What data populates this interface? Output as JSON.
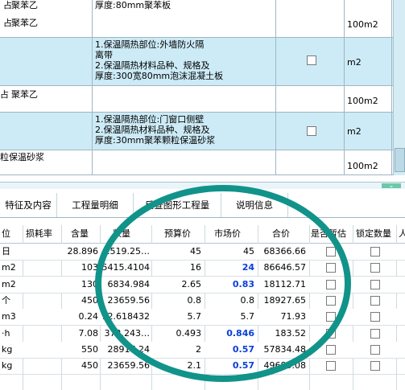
{
  "top_rows": [
    {
      "name": "聚苯乙",
      "prefix": "",
      "desc": "厚度:80mm聚苯板",
      "unit": "100m2",
      "checkbox": false
    },
    {
      "name": "",
      "prefix": "",
      "desc": "1.保温隔热部位:外墙防火隔\n离带\n2.保温隔热材料品种、规格及\n厚度:300宽80mm泡沫混凝土板",
      "unit": "m2",
      "checkbox": true
    },
    {
      "name": "聚苯乙",
      "prefix": "占",
      "desc": "",
      "unit": "100m2",
      "checkbox": false
    },
    {
      "name": "",
      "prefix": "",
      "desc": "1.保温隔热部位:门窗口侧壁\n2.保温隔热材料品种、规格及\n厚度:30mm聚苯颗粒保温砂浆",
      "unit": "m2",
      "checkbox": true
    },
    {
      "name": "粒保温砂浆",
      "prefix": "",
      "desc": "",
      "unit": "100m2",
      "checkbox": false
    }
  ],
  "first_row_prefix": "占",
  "tabs": [
    "特征及内容",
    "工程量明细",
    "反查图形工程量",
    "说明信息"
  ],
  "columns": [
    "位",
    "损耗率",
    "含量",
    "数量",
    "预算价",
    "市场价",
    "合价",
    "是否暂估",
    "锁定数量",
    "人"
  ],
  "rows": [
    {
      "unit": "日",
      "loss": "",
      "content": "28.896",
      "qty": "1519.25…",
      "budget": "45",
      "market": "45",
      "total": "68366.66",
      "market_bold": false
    },
    {
      "unit": "m2",
      "loss": "",
      "content": "103",
      "qty": "5415.4104",
      "budget": "16",
      "market": "24",
      "total": "86646.57",
      "market_bold": true
    },
    {
      "unit": "m2",
      "loss": "",
      "content": "130",
      "qty": "6834.984",
      "budget": "2.65",
      "market": "0.83",
      "total": "18112.71",
      "market_bold": true
    },
    {
      "unit": "个",
      "loss": "",
      "content": "450",
      "qty": "23659.56",
      "budget": "0.8",
      "market": "0.8",
      "total": "18927.65",
      "market_bold": false
    },
    {
      "unit": "m3",
      "loss": "",
      "content": "0.24",
      "qty": "12.618432",
      "budget": "5.7",
      "market": "5.7",
      "total": "71.93",
      "market_bold": false
    },
    {
      "unit": "·h",
      "loss": "",
      "content": "7.08",
      "qty": "372.243…",
      "budget": "0.493",
      "market": "0.846",
      "total": "183.52",
      "market_bold": true
    },
    {
      "unit": "kg",
      "loss": "",
      "content": "550",
      "qty": "28917.24",
      "budget": "2",
      "market": "0.57",
      "total": "57834.48",
      "market_bold": true
    },
    {
      "unit": "kg",
      "loss": "",
      "content": "450",
      "qty": "23659.56",
      "budget": "2.1",
      "market": "0.57",
      "total": "49685.08",
      "market_bold": true
    }
  ],
  "colors": {
    "band": "#cdebf7",
    "ring": "#11938a",
    "bold_value": "#0a3fd6"
  }
}
